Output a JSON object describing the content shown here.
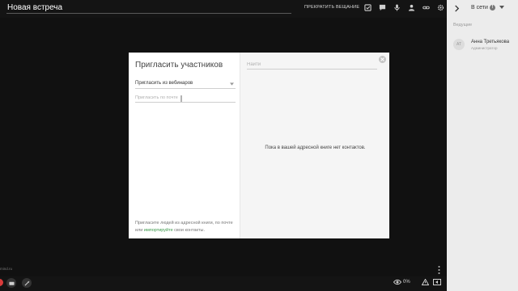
{
  "header": {
    "title": "Новая встреча",
    "stop_broadcast": "ПРЕКРАТИТЬ ВЕЩАНИЕ",
    "icons": [
      "checklist-icon",
      "chat-icon",
      "microphone-icon",
      "user-icon",
      "link-icon",
      "settings-icon"
    ]
  },
  "sidebar": {
    "status_label": "В сети",
    "info": "!",
    "section": "Ведущие",
    "user": {
      "initials": "АТ",
      "name": "Анна Третьякова",
      "role": "Администратор"
    }
  },
  "modal": {
    "title": "Пригласить участников",
    "invite_source": "Пригласить из вебинаров",
    "email_placeholder": "Пригласить по почте",
    "footer_before": "Пригласите людей из адресной книги, по почте или ",
    "footer_link": "импортируйте",
    "footer_after": " свои контакты.",
    "search_placeholder": "Найти",
    "empty_message": "Пока в вашей адресной книге нет контактов."
  },
  "bottom": {
    "powered_by": "mind.ru",
    "viewers_value": "0%"
  },
  "colors": {
    "accent_green": "#3d9a4c",
    "record_red": "#d93b3b",
    "stage_bg": "#111111",
    "panel_bg": "#ececec"
  }
}
